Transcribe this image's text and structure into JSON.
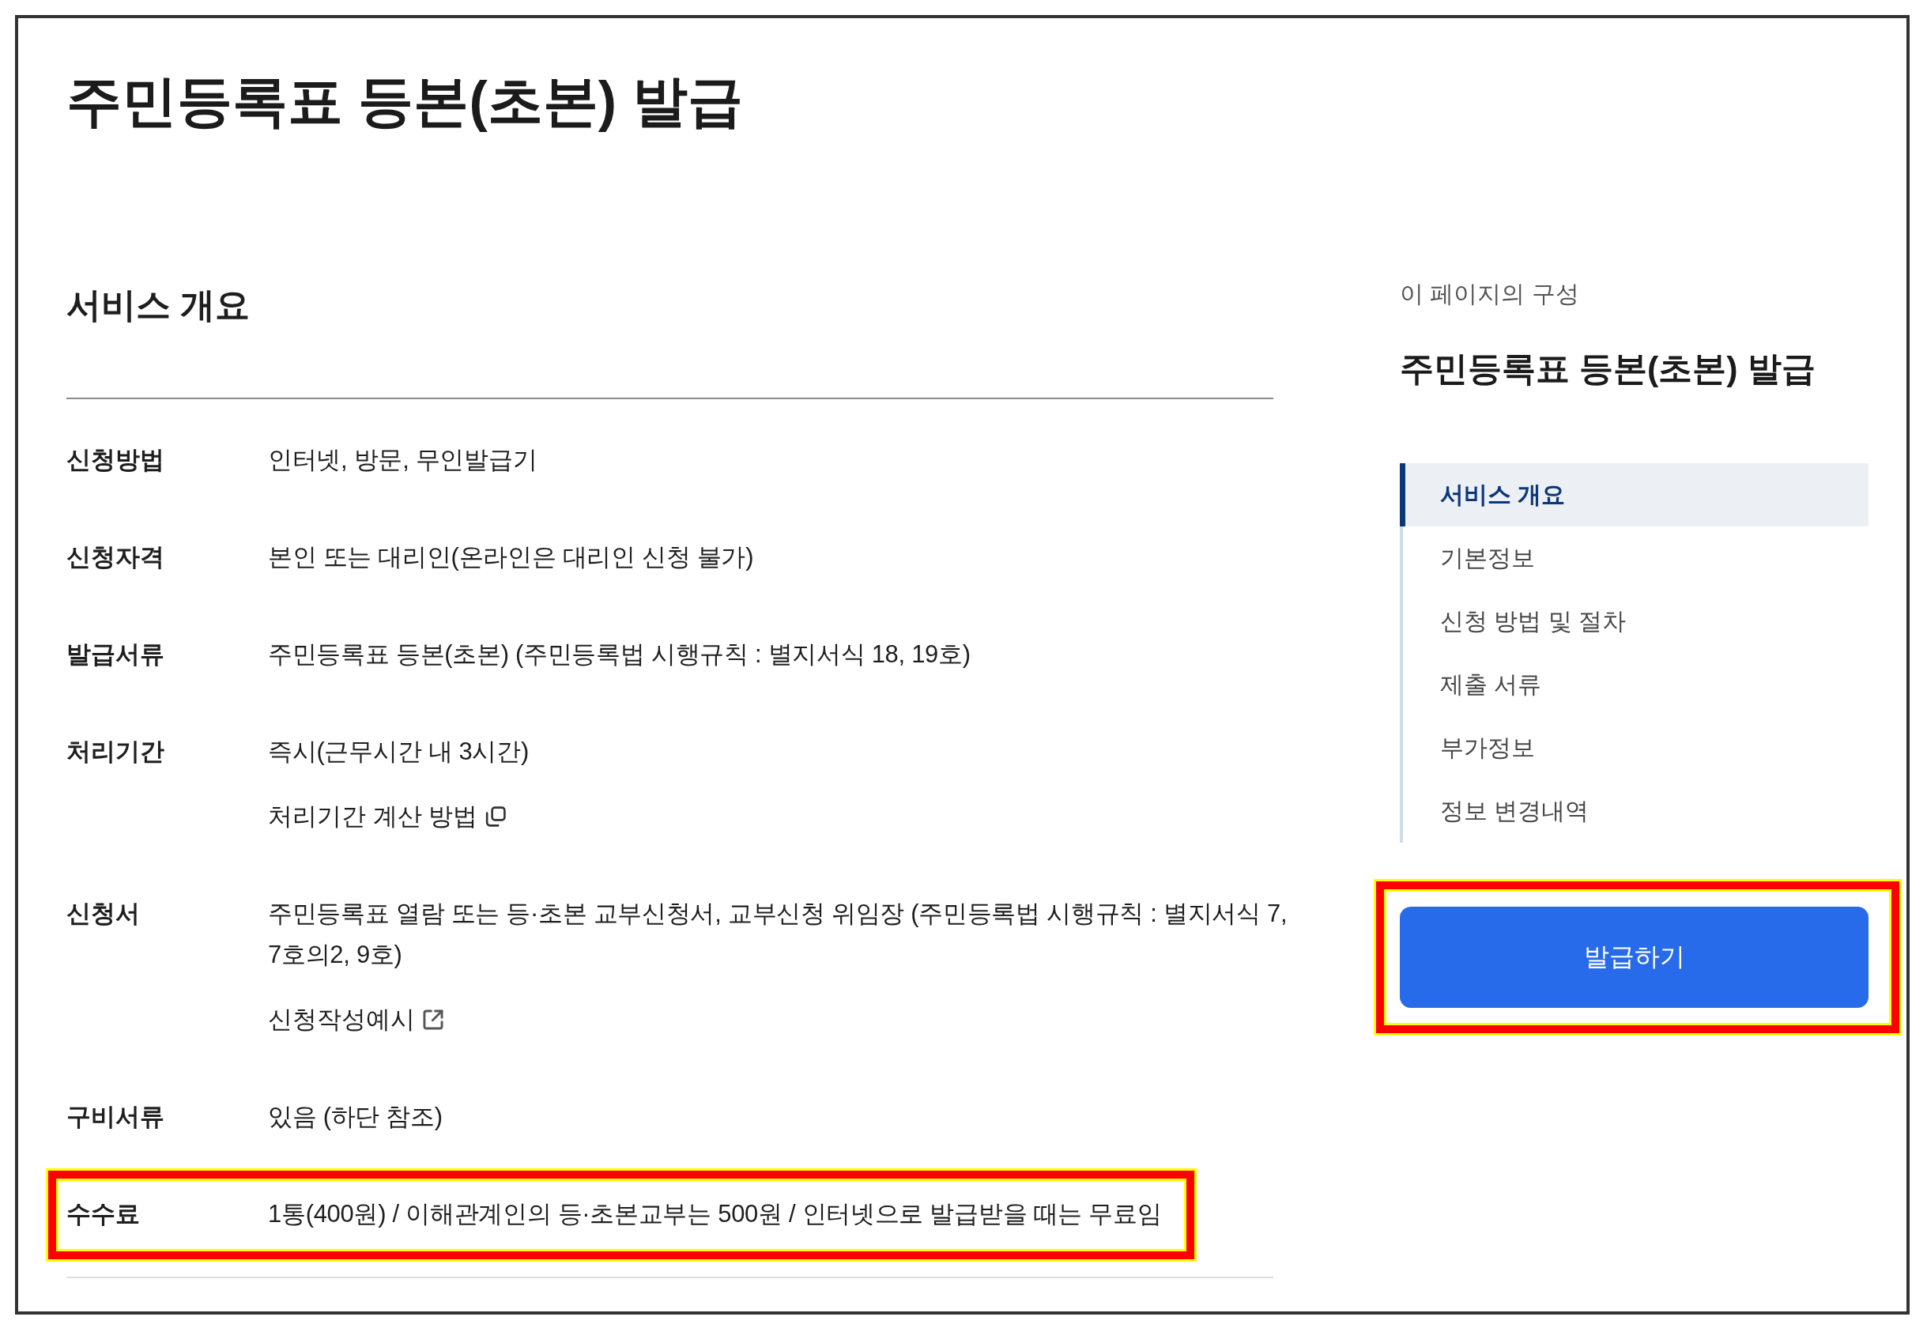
{
  "page": {
    "title": "주민등록표 등본(초본) 발급"
  },
  "overview": {
    "heading": "서비스 개요",
    "rows": [
      {
        "label": "신청방법",
        "value": "인터넷, 방문, 무인발급기",
        "highlighted": false
      },
      {
        "label": "신청자격",
        "value": "본인 또는 대리인(온라인은 대리인 신청 불가)",
        "highlighted": false
      },
      {
        "label": "발급서류",
        "value": "주민등록표 등본(초본) (주민등록법 시행규칙 : 별지서식 18, 19호)",
        "highlighted": false
      },
      {
        "label": "처리기간",
        "value": "즉시(근무시간 내 3시간)",
        "link": {
          "text": "처리기간 계산 방법",
          "kind": "popup"
        },
        "highlighted": false
      },
      {
        "label": "신청서",
        "value": "주민등록표 열람 또는 등·초본 교부신청서, 교부신청 위임장 (주민등록법 시행규칙 : 별지서식 7, 7호의2, 9호)",
        "link": {
          "text": "신청작성예시",
          "kind": "external"
        },
        "highlighted": false
      },
      {
        "label": "구비서류",
        "value": "있음 (하단 참조)",
        "highlighted": false
      },
      {
        "label": "수수료",
        "value": "1통(400원) / 이해관계인의 등·초본교부는 500원 / 인터넷으로 발급받을 때는 무료임",
        "highlighted": true
      }
    ]
  },
  "sidebar": {
    "caption": "이 페이지의 구성",
    "title": "주민등록표 등본(초본) 발급",
    "nav": [
      {
        "label": "서비스 개요",
        "selected": true
      },
      {
        "label": "기본정보",
        "selected": false
      },
      {
        "label": "신청 방법 및 절차",
        "selected": false
      },
      {
        "label": "제출 서류",
        "selected": false
      },
      {
        "label": "부가정보",
        "selected": false
      },
      {
        "label": "정보 변경내역",
        "selected": false
      }
    ],
    "button": {
      "label": "발급하기",
      "highlighted": true
    }
  }
}
